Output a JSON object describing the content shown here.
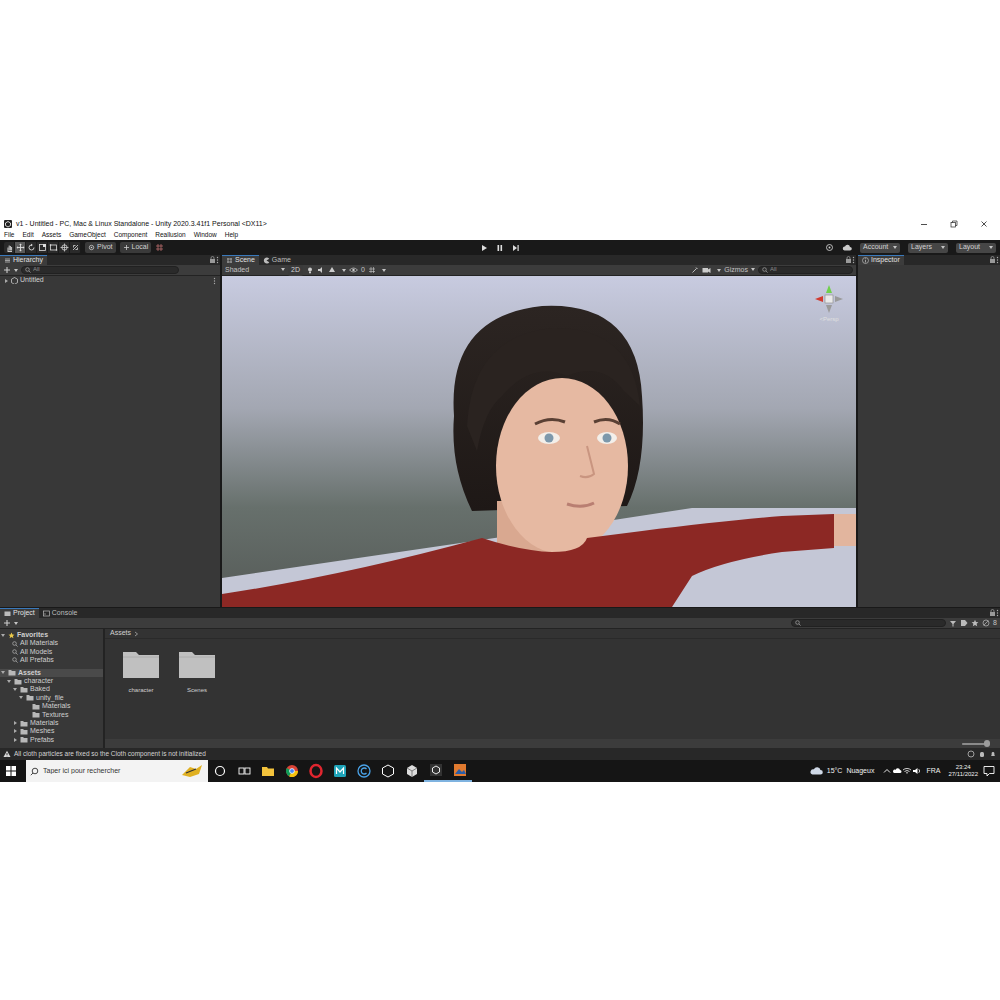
{
  "window": {
    "title": "v1 - Untitled - PC, Mac & Linux Standalone - Unity 2020.3.41f1 Personal <DX11>"
  },
  "menu": [
    "File",
    "Edit",
    "Assets",
    "GameObject",
    "Component",
    "Reallusion",
    "Window",
    "Help"
  ],
  "toolbar": {
    "tools": [
      {
        "selected": false
      },
      {
        "selected": true
      },
      {
        "selected": false
      },
      {
        "selected": false
      },
      {
        "selected": false
      },
      {
        "selected": false
      },
      {
        "selected": false
      }
    ],
    "pivot": "Pivot",
    "local": "Local",
    "right": [
      "Account",
      "Layers",
      "Layout"
    ]
  },
  "hierarchy": {
    "title": "Hierarchy",
    "search": "All",
    "items": [
      {
        "label": "Untitled",
        "expanded": false,
        "selected": false
      }
    ]
  },
  "scene": {
    "tabs": [
      {
        "label": "Scene",
        "selected": true
      },
      {
        "label": "Game",
        "selected": false
      }
    ],
    "shading": "Shaded",
    "mode2d": "2D",
    "hidden_count": "0",
    "gizmos": "Gizmos",
    "search": "All",
    "projection": "<Persp"
  },
  "inspector": {
    "title": "Inspector"
  },
  "project": {
    "tabs": [
      {
        "label": "Project",
        "selected": true
      },
      {
        "label": "Console",
        "selected": false
      }
    ],
    "favorites": {
      "label": "Favorites",
      "expanded": true,
      "items": [
        "All Materials",
        "All Models",
        "All Prefabs"
      ]
    },
    "tree": [
      {
        "label": "Assets",
        "depth": 0,
        "kind": "open",
        "selected": true
      },
      {
        "label": "character",
        "depth": 1,
        "kind": "open",
        "selected": false
      },
      {
        "label": "Baked",
        "depth": 2,
        "kind": "open",
        "selected": false
      },
      {
        "label": "unity_file",
        "depth": 3,
        "kind": "open",
        "selected": false
      },
      {
        "label": "Materials",
        "depth": 4,
        "kind": "leaf",
        "selected": false
      },
      {
        "label": "Textures",
        "depth": 4,
        "kind": "leaf",
        "selected": false
      },
      {
        "label": "Materials",
        "depth": 2,
        "kind": "closed",
        "selected": false
      },
      {
        "label": "Meshes",
        "depth": 2,
        "kind": "closed",
        "selected": false
      },
      {
        "label": "Prefabs",
        "depth": 2,
        "kind": "closed",
        "selected": false
      }
    ],
    "breadcrumb": "Assets",
    "folders": [
      {
        "label": "character"
      },
      {
        "label": "Scenes"
      }
    ],
    "hidden_count": "8",
    "icon_size": {
      "level": 0.9
    }
  },
  "status": {
    "message": "All cloth particles are fixed so the Cloth component is not initialized"
  },
  "taskbar": {
    "search": "Taper ici pour rechercher",
    "weather": {
      "temp": "15°C",
      "label": "Nuageux"
    },
    "lang": "FRA",
    "time": "23:24",
    "date": "27/11/2022"
  }
}
